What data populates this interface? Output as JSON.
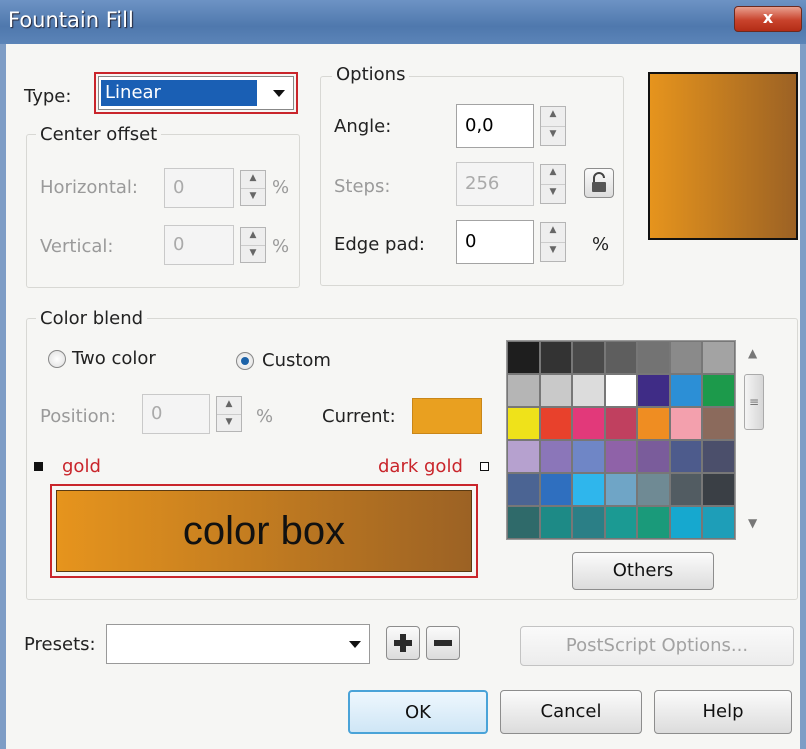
{
  "window": {
    "title": "Fountain Fill",
    "close_glyph": "x"
  },
  "type": {
    "label": "Type:",
    "value": "Linear"
  },
  "center_offset": {
    "legend": "Center offset",
    "horizontal_label": "Horizontal:",
    "horizontal_value": "0",
    "vertical_label": "Vertical:",
    "vertical_value": "0",
    "unit": "%"
  },
  "options": {
    "legend": "Options",
    "angle_label": "Angle:",
    "angle_value": "0,0",
    "steps_label": "Steps:",
    "steps_value": "256",
    "edge_pad_label": "Edge pad:",
    "edge_pad_value": "0",
    "unit": "%"
  },
  "color_blend": {
    "legend": "Color blend",
    "two_color_label": "Two color",
    "custom_label": "Custom",
    "position_label": "Position:",
    "position_value": "0",
    "unit": "%",
    "current_label": "Current:",
    "gold_label": "gold",
    "dark_gold_label": "dark gold",
    "color_box_label": "color box",
    "others_label": "Others"
  },
  "presets": {
    "label": "Presets:",
    "value": "",
    "postscript_label": "PostScript Options..."
  },
  "buttons": {
    "ok": "OK",
    "cancel": "Cancel",
    "help": "Help"
  },
  "colors": {
    "gold": "#e6941d",
    "dark_gold": "#9c6224",
    "current": "#e9a020",
    "highlight": "#1a5fb4",
    "annotation_red": "#c9252b"
  },
  "palette": [
    "#1e1e1e",
    "#333333",
    "#4a4a4a",
    "#5e5e5e",
    "#737373",
    "#8a8a8a",
    "#a3a3a3",
    "#b5b5b5",
    "#c9c9c9",
    "#dcdcdc",
    "#ffffff",
    "#3f2c86",
    "#2c8fd6",
    "#1c9a4b",
    "#efe21a",
    "#e8412c",
    "#e2397a",
    "#c0405f",
    "#ef8d22",
    "#f3a0ad",
    "#8b6a5c",
    "#b6a1cf",
    "#8b76b9",
    "#6f86c6",
    "#8f62a8",
    "#7a5c9b",
    "#4d5b8c",
    "#4b4f6b",
    "#4b6493",
    "#2f6fbf",
    "#2fb6ec",
    "#6fa5c6",
    "#6f8a94",
    "#525c62",
    "#3a3f45",
    "#2f6a6a",
    "#1d8a86",
    "#2b7f86",
    "#1b9a93",
    "#1a9a7a",
    "#16a8cf",
    "#1e9eb8"
  ]
}
